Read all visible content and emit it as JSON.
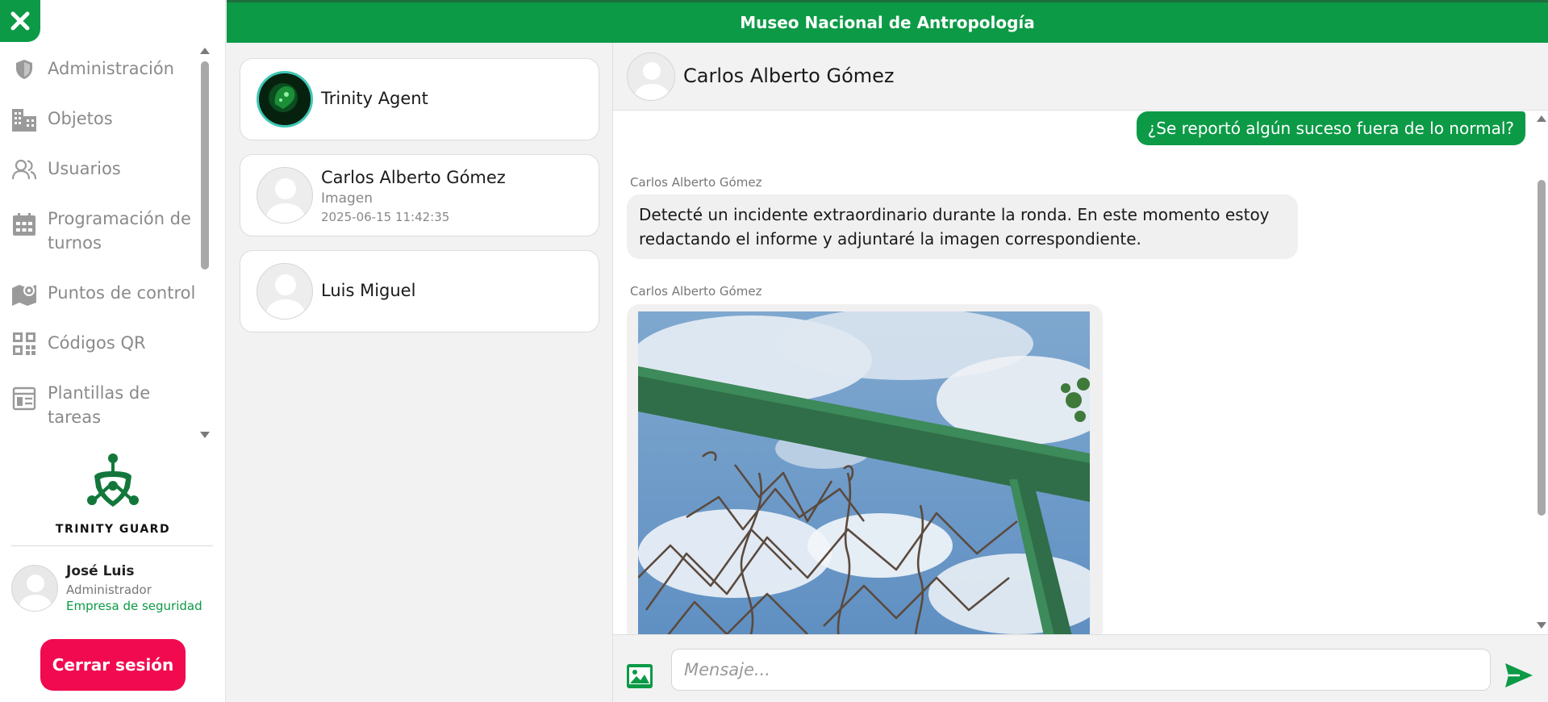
{
  "app": {
    "title": "Museo Nacional de Antropología"
  },
  "sidebar": {
    "items": [
      {
        "label": "Administración",
        "icon": "shield-icon"
      },
      {
        "label": "Objetos",
        "icon": "buildings-icon"
      },
      {
        "label": "Usuarios",
        "icon": "users-icon"
      },
      {
        "label": "Programación de turnos",
        "icon": "calendar-icon"
      },
      {
        "label": "Puntos de control",
        "icon": "map-pin-icon"
      },
      {
        "label": "Códigos QR",
        "icon": "qr-code-icon"
      },
      {
        "label": "Plantillas de tareas",
        "icon": "template-icon"
      }
    ],
    "logo_text": "TRINITY GUARD",
    "user": {
      "name": "José Luis",
      "role": "Administrador",
      "company": "Empresa de seguridad"
    },
    "logout_label": "Cerrar sesión"
  },
  "conversations": [
    {
      "name": "Trinity Agent",
      "avatar": "agent-avatar"
    },
    {
      "name": "Carlos Alberto Gómez",
      "last_message": "Imagen",
      "time": "2025-06-15 11:42:35",
      "avatar": "default-avatar"
    },
    {
      "name": "Luis Miguel",
      "avatar": "default-avatar"
    }
  ],
  "chat": {
    "contact_name": "Carlos Alberto Gómez",
    "messages": [
      {
        "direction": "out",
        "text": "¿Se reportó algún suceso fuera de lo normal?"
      },
      {
        "direction": "in",
        "sender": "Carlos Alberto Gómez",
        "text": "Detecté un incidente extraordinario durante la ronda. En este momento estoy redactando el informe y adjuntaré la imagen correspondiente."
      },
      {
        "direction": "in",
        "sender": "Carlos Alberto Gómez",
        "type": "image"
      }
    ],
    "input_placeholder": "Mensaje..."
  },
  "colors": {
    "brand_green": "#0c9a46",
    "logout_red": "#f10a4f",
    "sidebar_text": "#8a8a8a"
  }
}
